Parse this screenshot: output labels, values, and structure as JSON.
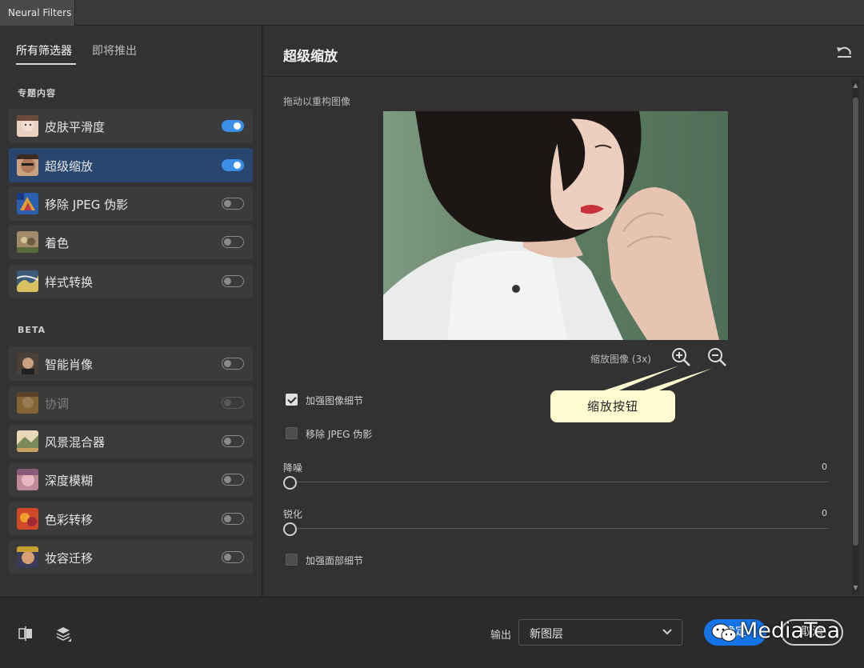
{
  "window": {
    "title": "Neural Filters"
  },
  "sidebar": {
    "tabs": [
      {
        "label": "所有筛选器",
        "active": true
      },
      {
        "label": "即将推出",
        "active": false
      }
    ],
    "sections": [
      {
        "label": "专题内容",
        "items": [
          {
            "label": "皮肤平滑度",
            "icon": "skin-smoothing-thumbnail",
            "enabled": true,
            "selected": false,
            "disabled": false
          },
          {
            "label": "超级缩放",
            "icon": "super-zoom-thumbnail",
            "enabled": true,
            "selected": true,
            "disabled": false
          },
          {
            "label": "移除 JPEG 伪影",
            "icon": "jpeg-artifacts-thumbnail",
            "enabled": false,
            "selected": false,
            "disabled": false
          },
          {
            "label": "着色",
            "icon": "colorize-thumbnail",
            "enabled": false,
            "selected": false,
            "disabled": false
          },
          {
            "label": "样式转换",
            "icon": "style-transfer-thumbnail",
            "enabled": false,
            "selected": false,
            "disabled": false
          }
        ]
      },
      {
        "label": "BETA",
        "items": [
          {
            "label": "智能肖像",
            "icon": "smart-portrait-thumbnail",
            "enabled": false,
            "selected": false,
            "disabled": false
          },
          {
            "label": "协调",
            "icon": "harmonization-thumbnail",
            "enabled": false,
            "selected": false,
            "disabled": true
          },
          {
            "label": "风景混合器",
            "icon": "landscape-mixer-thumbnail",
            "enabled": false,
            "selected": false,
            "disabled": false
          },
          {
            "label": "深度模糊",
            "icon": "depth-blur-thumbnail",
            "enabled": false,
            "selected": false,
            "disabled": false
          },
          {
            "label": "色彩转移",
            "icon": "color-transfer-thumbnail",
            "enabled": false,
            "selected": false,
            "disabled": false
          },
          {
            "label": "妆容迁移",
            "icon": "makeup-transfer-thumbnail",
            "enabled": false,
            "selected": false,
            "disabled": false
          }
        ]
      }
    ]
  },
  "main": {
    "title": "超级缩放",
    "reset_icon": "reset-icon",
    "preview_hint": "拖动以重构图像",
    "preview_image": "portrait-photo",
    "zoom_label": "缩放图像 (3x)",
    "zoom_in_icon": "zoom-in-icon",
    "zoom_out_icon": "zoom-out-icon",
    "callout": "缩放按钮",
    "enhance_detail": {
      "label": "加强图像细节",
      "checked": true
    },
    "remove_jpeg": {
      "label": "移除 JPEG 伪影",
      "checked": false
    },
    "noise": {
      "label": "降噪",
      "value": "0"
    },
    "sharpen": {
      "label": "锐化",
      "value": "0"
    },
    "enhance_face": {
      "label": "加强面部细节",
      "checked": false
    }
  },
  "footer": {
    "compare_icon": "compare-icon",
    "layers_icon": "layers-icon",
    "output_label": "输出",
    "output_value": "新图层",
    "ok_label": "确定",
    "cancel_label": "取消",
    "watermark": "MediaTea"
  },
  "colors": {
    "accent": "#1473e6",
    "selected_item": "#28466e",
    "toggle_on": "#3a8ee6",
    "callout_bg": "#fffbd1",
    "panel_bg": "#323232"
  }
}
